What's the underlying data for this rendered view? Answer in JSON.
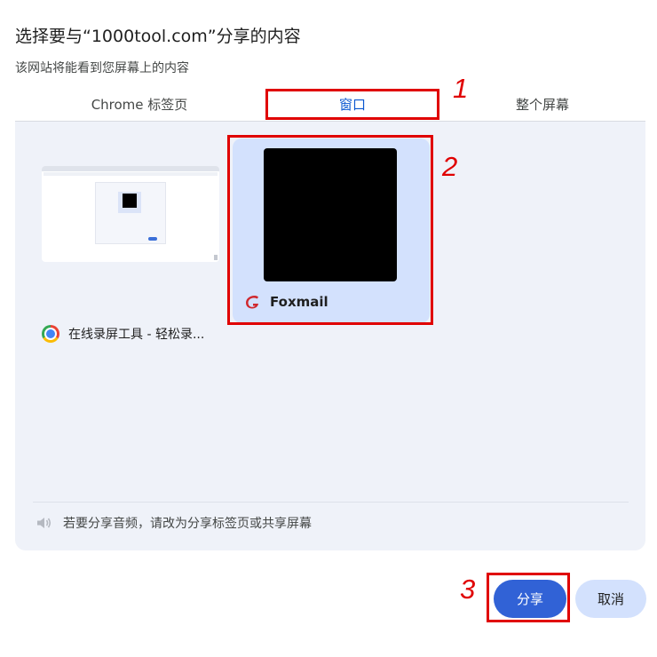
{
  "dialog": {
    "title": "选择要与“1000tool.com”分享的内容",
    "subtitle": "该网站将能看到您屏幕上的内容"
  },
  "tabs": [
    {
      "label": "Chrome 标签页",
      "selected": false
    },
    {
      "label": "窗口",
      "selected": true
    },
    {
      "label": "整个屏幕",
      "selected": false
    }
  ],
  "sources": [
    {
      "label": "在线录屏工具 - 轻松录...",
      "icon": "chrome-icon",
      "selected": false
    },
    {
      "label": "Foxmail",
      "icon": "foxmail-icon",
      "selected": true
    }
  ],
  "audio_note": "若要分享音频，请改为分享标签页或共享屏幕",
  "buttons": {
    "share": "分享",
    "cancel": "取消"
  },
  "annotations": [
    "1",
    "2",
    "3"
  ],
  "colors": {
    "accent": "#0b57d0",
    "primary_button": "#3162d6",
    "selected_card": "#d3e1fd",
    "panel": "#eff2f9",
    "annotation": "#e00000"
  }
}
